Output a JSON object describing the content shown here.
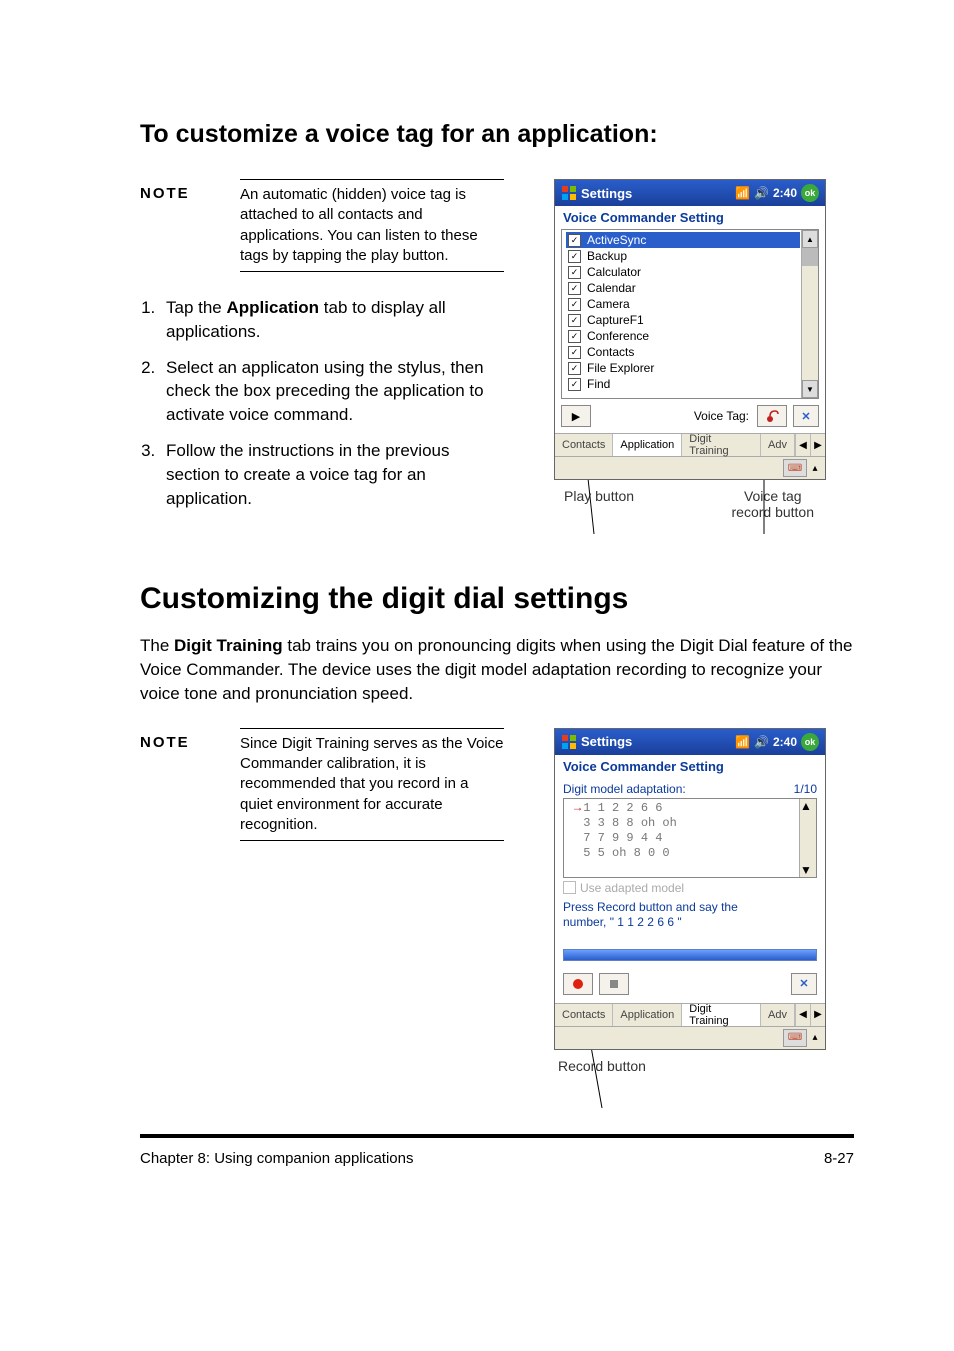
{
  "section2_title": "Customizing the digit dial settings",
  "section1_title": "To customize a voice tag for an application:",
  "note_label": "NOTE",
  "note1_text": "An automatic (hidden) voice tag is attached to all contacts and applications. You can listen to these tags by tapping the play button.",
  "steps": {
    "s1_a": "Tap the ",
    "s1_b": "Application",
    "s1_c": " tab to display all applications.",
    "s2": "Select an applicaton using the stylus, then check the box preceding the application to activate voice command.",
    "s3": "Follow the instructions in the previous section to create a voice tag for an application."
  },
  "body_para_a": "The ",
  "body_para_b": "Digit Training",
  "body_para_c": " tab trains you on pronouncing digits when using the Digit Dial feature of the Voice Commander. The device uses the digit model adaptation recording to recognize your voice tone and pronunciation speed.",
  "note2_text": "Since Digit Training serves as the Voice Commander calibration, it is recommended that you record in a quiet environment for accurate recognition.",
  "callouts": {
    "play": "Play button",
    "record_tag_l1": "Voice tag",
    "record_tag_l2": "record button",
    "record_btn": "Record button"
  },
  "wm": {
    "title": "Settings",
    "time": "2:40",
    "ok": "ok",
    "subtitle": "Voice Commander Setting",
    "voice_tag_label": "Voice Tag:",
    "tabs": [
      "Contacts",
      "Application",
      "Digit Training",
      "Adv"
    ],
    "applist": [
      "ActiveSync",
      "Backup",
      "Calculator",
      "Calendar",
      "Camera",
      "CaptureF1",
      "Conference",
      "Contacts",
      "File Explorer",
      "Find"
    ],
    "digit": {
      "field_label": "Digit model adaptation:",
      "counter": "1/10",
      "rows": [
        "1 1 2 2 6 6",
        "3 3 8 8 oh oh",
        "7 7 9 9 4 4",
        "5 5 oh 8 0 0"
      ],
      "use_adapted": "Use adapted model",
      "hint_l1": "Press Record button and say the",
      "hint_l2": "number, \" 1 1 2 2 6 6 \""
    }
  },
  "footer_left": "Chapter 8: Using companion applications",
  "footer_right": "8-27"
}
